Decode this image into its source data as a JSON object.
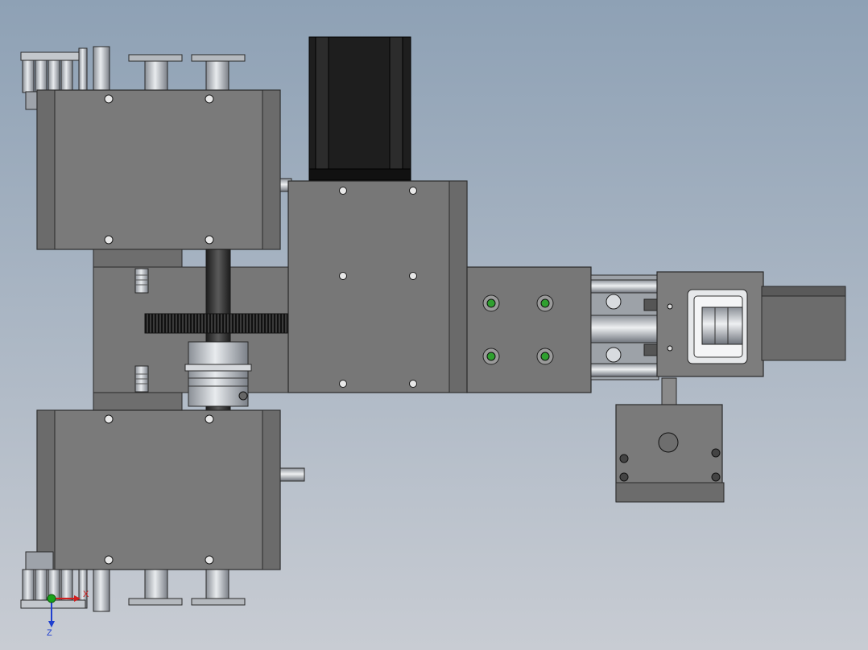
{
  "scene": {
    "kind": "cad-assembly-viewport",
    "background_top": "#8ea1b5",
    "background_bottom": "#c8ccd3"
  },
  "colors": {
    "housing": "#7a7a7a",
    "housing_dark": "#5f5f5f",
    "housing_light": "#a6a6a6",
    "outline": "#2a2a2a",
    "motor": "#1e1e1e",
    "steel": "#c9ced4",
    "bolt_green": "#2fa02f",
    "axis_x": "#d11f1f",
    "axis_y": "#1aa31a",
    "axis_z": "#1f3fcf"
  },
  "triad": {
    "x_label": "X",
    "z_label": "Z"
  }
}
